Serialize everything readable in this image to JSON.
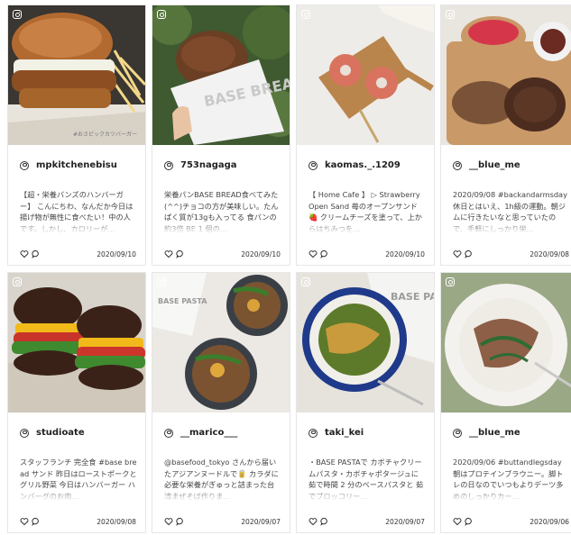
{
  "posts": [
    {
      "username": "mpkitchenebisu",
      "caption": "【超・栄養バンズのハンバーガー】 こんにちわ、なんだか今日は揚げ物が無性に食べたい！中の人です。しかし、カロリーが…",
      "date": "2020/09/10",
      "photo_text": "#おさピックカツバーガー"
    },
    {
      "username": "753nagaga",
      "caption": "栄養パンBASE BREAD食べてみた(^^)チョコの方が美味しい。たんぱく質が13gも入ってる 食パンの約3倍 BE 1 個の…",
      "date": "2020/09/10",
      "photo_text": "BASE BREAD"
    },
    {
      "username": "kaomas._.1209",
      "caption": "【 Home Cafe 】 ▷ Strawberry Open Sand 苺のオープンサンド🍓 クリームチーズを塗って、上からはちみつを…",
      "date": "2020/09/10"
    },
    {
      "username": "__blue_me",
      "caption": "2020/09/08 #backandarmsday 休日とはいえ、1h級の運動。朝ジムに行きたいなと思っていたので、手軽にしっかり栄…",
      "date": "2020/09/08"
    },
    {
      "username": "studioate",
      "caption": "スタッフランチ 完全食 #base bread サンド 昨日はローストポークとグリル野菜 今日はハンバーガー ハンバーグのお肉…",
      "date": "2020/09/08"
    },
    {
      "username": "__marico___",
      "caption": "@basefood_tokyo さんから届いたアジアンヌードルで🥫 カラダに必要な栄養がぎゅっと詰まった台湾まぜそば作りま…",
      "date": "2020/09/07",
      "photo_text": "BASE PASTA"
    },
    {
      "username": "taki_kei",
      "caption": "・BASE PASTAで カボチャクリームパスタ・カボチャポタージュに 茹で時間 2 分のベースパスタと 茹でブロッコリー…",
      "date": "2020/09/07",
      "photo_text": "BASE PASTA"
    },
    {
      "username": "__blue_me",
      "caption": "2020/09/06 #buttandlegsday 朝はプロテインブラウニー。脚トレの日なのでいつもよりデーツ多めのしっかりカー…",
      "date": "2020/09/06"
    }
  ],
  "colors": {
    "border": "#e6e6e6",
    "text": "#333333",
    "caption": "#444444"
  },
  "icons": [
    "instagram-icon",
    "user-icon",
    "heart-icon",
    "comment-icon"
  ]
}
